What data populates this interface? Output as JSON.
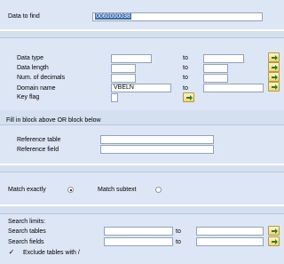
{
  "find": {
    "label": "Data to find",
    "value": "0060000038"
  },
  "attributes": {
    "data_type_label": "Data type",
    "data_length_label": "Data length",
    "num_decimals_label": "Num. of decimals",
    "domain_name_label": "Domain name",
    "domain_name_from": "VBELN",
    "key_flag_label": "Key flag",
    "to_label": "to"
  },
  "reference": {
    "heading": "Fill in block above OR block below",
    "table_label": "Reference table",
    "field_label": "Reference field"
  },
  "match": {
    "exact_label": "Match exactly",
    "subtext_label": "Match subtext",
    "selected": "exact"
  },
  "limits": {
    "heading": "Search limits:",
    "tables_label": "Search tables",
    "fields_label": "Search fields",
    "to_label": "to",
    "exclude_label": "Exclude tables with /",
    "exclude_checked": true,
    "exclude_mark": "✓"
  },
  "colors": {
    "background": "#d4e0f0",
    "panel": "#dce6f4",
    "selection": "#3b6ea8",
    "button_yellow": "#f2d470"
  }
}
